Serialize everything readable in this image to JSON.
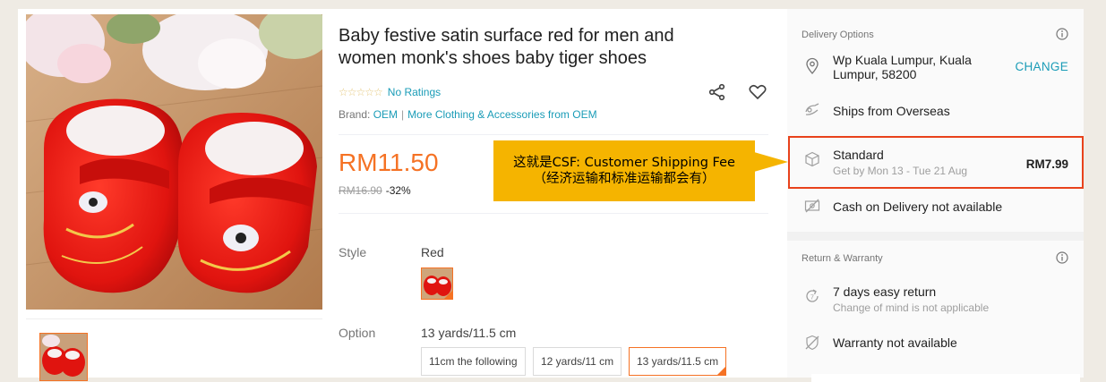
{
  "product": {
    "title": "Baby festive satin surface red for men and women monk's shoes baby tiger shoes",
    "stars": "☆☆☆☆☆",
    "ratings_text": "No Ratings",
    "brand_label": "Brand:",
    "brand": "OEM",
    "more_link": "More Clothing & Accessories from OEM",
    "price": "RM11.50",
    "original_price": "RM16.90",
    "discount": "-32%",
    "style_label": "Style",
    "style_value": "Red",
    "option_label": "Option",
    "option_value": "13 yards/11.5 cm",
    "options": [
      {
        "label": "11cm the following",
        "selected": false
      },
      {
        "label": "12 yards/11 cm",
        "selected": false
      },
      {
        "label": "13 yards/11.5 cm",
        "selected": true
      }
    ]
  },
  "annotation": {
    "line1": "这就是CSF: Customer Shipping Fee",
    "line2": "（经济运输和标准运输都会有）"
  },
  "delivery": {
    "heading": "Delivery Options",
    "address": "Wp Kuala Lumpur, Kuala Lumpur, 58200",
    "change": "CHANGE",
    "ships_from": "Ships from Overseas",
    "standard": "Standard",
    "standard_eta": "Get by Mon 13 - Tue 21 Aug",
    "standard_fee": "RM7.99",
    "cod": "Cash on Delivery not available"
  },
  "warranty": {
    "heading": "Return & Warranty",
    "return": "7 days easy return",
    "return_sub": "Change of mind is not applicable",
    "warranty": "Warranty not available"
  },
  "colors": {
    "accent": "#f57224",
    "link": "#1a9cb7",
    "callout": "#f5b400",
    "highlight": "#e8421b"
  }
}
